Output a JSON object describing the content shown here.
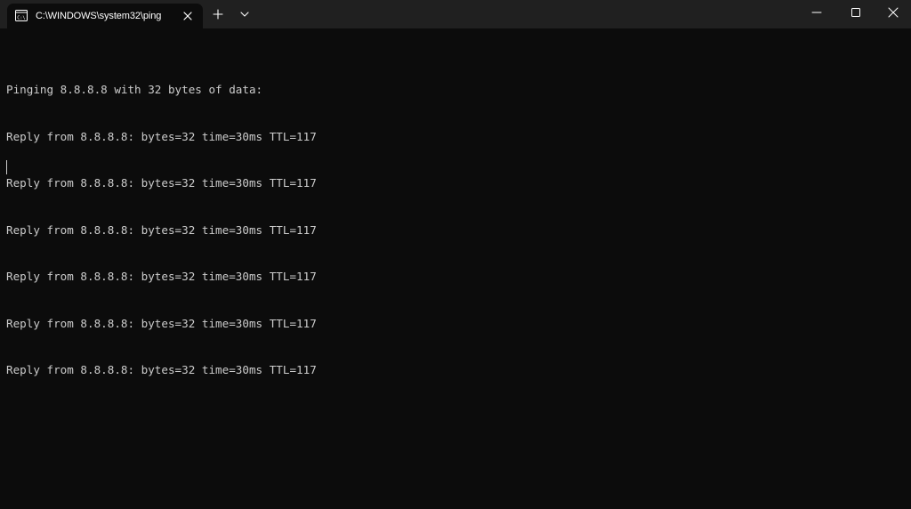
{
  "tab": {
    "title": "C:\\WINDOWS\\system32\\ping"
  },
  "console": {
    "lines": [
      "Pinging 8.8.8.8 with 32 bytes of data:",
      "Reply from 8.8.8.8: bytes=32 time=30ms TTL=117",
      "Reply from 8.8.8.8: bytes=32 time=30ms TTL=117",
      "Reply from 8.8.8.8: bytes=32 time=30ms TTL=117",
      "Reply from 8.8.8.8: bytes=32 time=30ms TTL=117",
      "Reply from 8.8.8.8: bytes=32 time=30ms TTL=117",
      "Reply from 8.8.8.8: bytes=32 time=30ms TTL=117"
    ]
  },
  "icons": {
    "tab_icon": "terminal-icon",
    "close_tab": "close-icon",
    "new_tab": "plus-icon",
    "dropdown": "chevron-down-icon",
    "minimize": "minimize-icon",
    "maximize": "maximize-icon",
    "close_window": "close-icon"
  },
  "colors": {
    "background": "#0c0c0c",
    "titlebar": "#202020",
    "text": "#cccccc"
  }
}
